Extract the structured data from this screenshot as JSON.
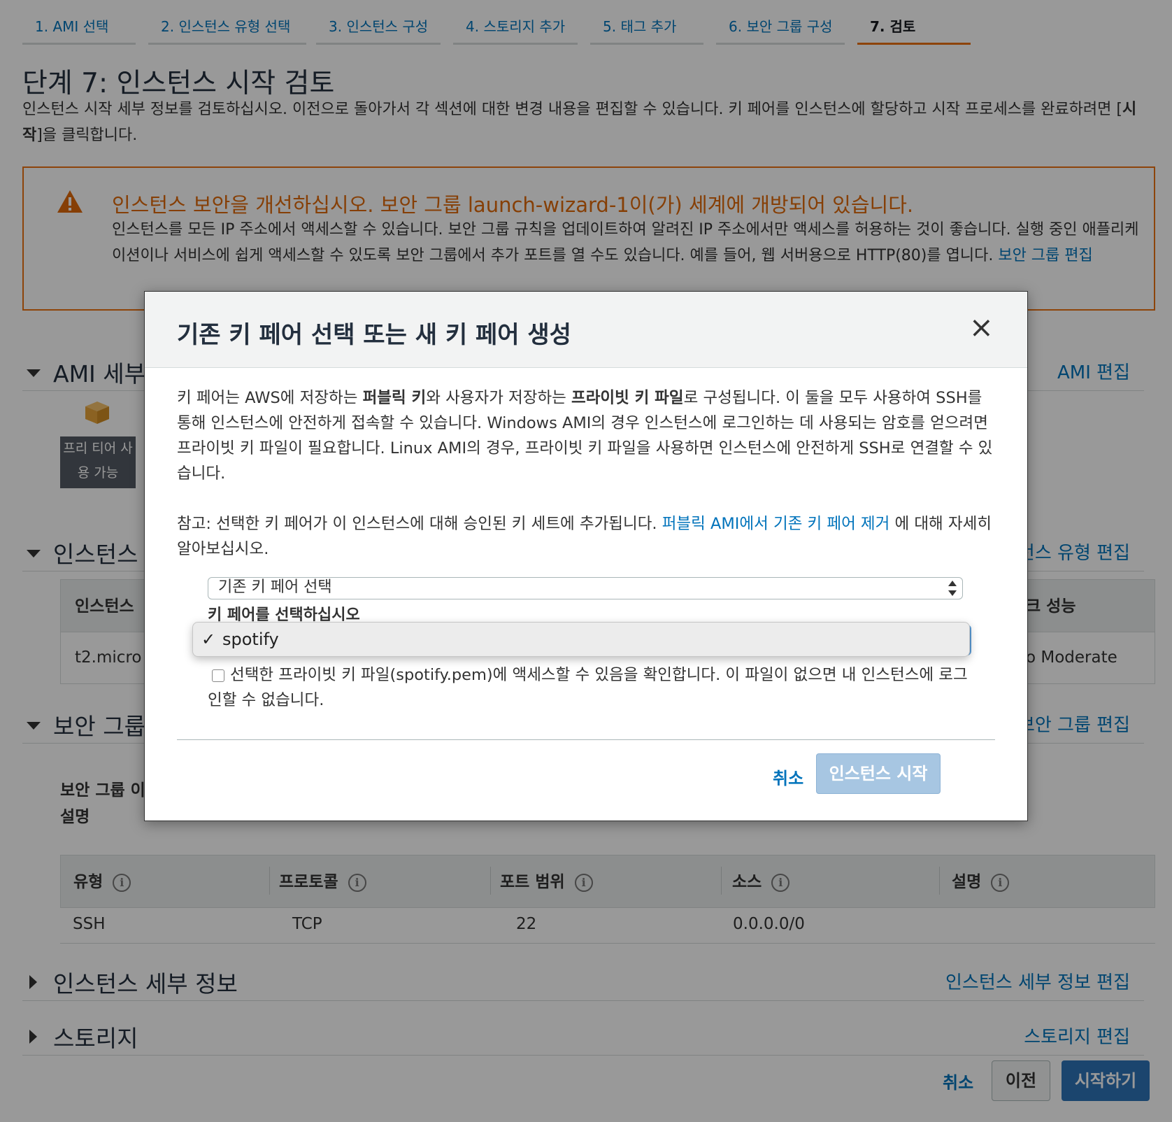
{
  "wizard_tabs": [
    "1. AMI 선택",
    "2. 인스턴스 유형 선택",
    "3. 인스턴스 구성",
    "4. 스토리지 추가",
    "5. 태그 추가",
    "6. 보안 그룹 구성",
    "7. 검토"
  ],
  "page": {
    "title": "단계 7: 인스턴스 시작 검토",
    "intro_1": "인스턴스 시작 세부 정보를 검토하십시오. 이전으로 돌아가서 각 섹션에 대한 변경 내용을 편집할 수 있습니다. 키 페어를 인스턴스에 할당하고 시작 프로세스를 완료하려면 [",
    "intro_bold": "시작",
    "intro_2": "]을 클릭합니다."
  },
  "warning": {
    "title": "인스턴스 보안을 개선하십시오. 보안 그룹 launch-wizard-1이(가) 세계에 개방되어 있습니다.",
    "body": "인스턴스를 모든 IP 주소에서 액세스할 수 있습니다. 보안 그룹 규칙을 업데이트하여 알려진 IP 주소에서만 액세스를 허용하는 것이 좋습니다. 실행 중인 애플리케이션이나 서비스에 쉽게 액세스할 수 있도록 보안 그룹에서 추가 포트를 열 수도 있습니다. 예를 들어, 웹 서버용으로 HTTP(80)를 엽니다.",
    "link": "보안 그룹 편집",
    "icon": "warning-triangle-icon",
    "color": "#df6a0b"
  },
  "sections": {
    "ami": {
      "title": "AMI 세부",
      "edit": "AMI 편집",
      "badge": "프리 티어 사용 가능",
      "icon": "package-icon"
    },
    "instance_type": {
      "title": "인스턴스 ",
      "edit": "스턴스 유형 편집",
      "col_first": "인스턴스 ",
      "col_last": "크 성능",
      "row_first": "t2.micro",
      "row_last": "o Moderate"
    },
    "security": {
      "title": "보안 그룹",
      "edit": "보안 그룹 편집",
      "name_label": "보안 그룹 이",
      "desc_label": "설명",
      "columns": [
        "유형",
        "프로토콜",
        "포트 범위",
        "소스",
        "설명"
      ],
      "rows": [
        [
          "SSH",
          "TCP",
          "22",
          "0.0.0.0/0",
          ""
        ]
      ]
    },
    "instance_details": {
      "title": "인스턴스 세부 정보",
      "edit": "인스턴스 세부 정보 편집"
    },
    "storage": {
      "title": "스토리지",
      "edit": "스토리지 편집"
    }
  },
  "footer": {
    "cancel": "취소",
    "previous": "이전",
    "launch": "시작하기"
  },
  "modal": {
    "title": "기존 키 페어 선택 또는 새 키 페어 생성",
    "close": "×",
    "p1_a": "키 페어는 AWS에 저장하는 ",
    "p1_b": "퍼블릭 키",
    "p1_c": "와 사용자가 저장하는 ",
    "p1_d": "프라이빗 키 파일",
    "p1_e": "로 구성됩니다. 이 둘을 모두 사용하여 SSH를 통해 인스턴스에 안전하게 접속할 수 있습니다. Windows AMI의 경우 인스턴스에 로그인하는 데 사용되는 암호를 얻으려면 프라이빗 키 파일이 필요합니다. Linux AMI의 경우, 프라이빗 키 파일을 사용하면 인스턴스에 안전하게 SSH로 연결할 수 있습니다.",
    "p2_a": "참고: 선택한 키 페어가 이 인스턴스에 대해 승인된 키 세트에 추가됩니다. ",
    "p2_link": "퍼블릭 AMI에서 기존 키 페어 제거",
    "p2_b": " 에 대해 자세히 알아보십시오.",
    "key_action": "기존 키 페어 선택",
    "key_label": "키 페어를 선택하십시오",
    "key_option_check": "✓",
    "key_option": "spotify",
    "ack_text": "선택한 프라이빗 키 파일(spotify.pem)에 액세스할 수 있음을 확인합니다. 이 파일이 없으면 내 인스턴스에 로그인할 수 없습니다.",
    "cancel": "취소",
    "launch": "인스턴스 시작"
  }
}
